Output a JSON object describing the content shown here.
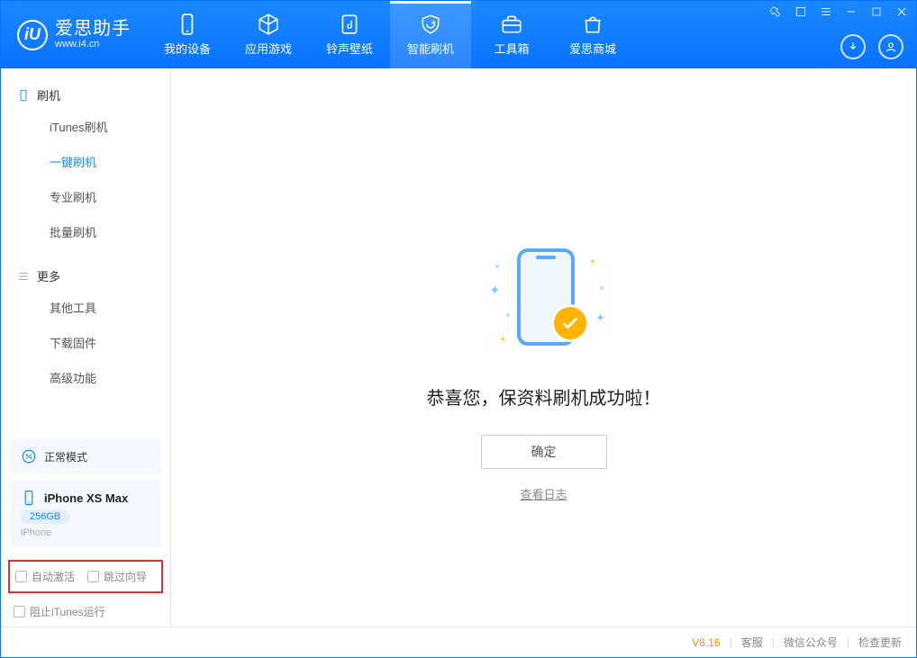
{
  "app": {
    "name": "爱思助手",
    "domain": "www.i4.cn"
  },
  "nav": {
    "items": [
      {
        "label": "我的设备"
      },
      {
        "label": "应用游戏"
      },
      {
        "label": "铃声壁纸"
      },
      {
        "label": "智能刷机"
      },
      {
        "label": "工具箱"
      },
      {
        "label": "爱思商城"
      }
    ]
  },
  "sidebar": {
    "section1": {
      "title": "刷机",
      "items": [
        "iTunes刷机",
        "一键刷机",
        "专业刷机",
        "批量刷机"
      ]
    },
    "section2": {
      "title": "更多",
      "items": [
        "其他工具",
        "下载固件",
        "高级功能"
      ]
    },
    "mode": "正常模式",
    "device": {
      "name": "iPhone XS Max",
      "capacity": "256GB",
      "type": "iPhone"
    },
    "options": {
      "auto_activate": "自动激活",
      "skip_guide": "跳过向导"
    },
    "block_itunes": "阻止iTunes运行"
  },
  "main": {
    "success_text": "恭喜您，保资料刷机成功啦！",
    "confirm": "确定",
    "view_log": "查看日志"
  },
  "footer": {
    "version": "V8.16",
    "support": "客服",
    "wechat": "微信公众号",
    "update": "检查更新"
  }
}
